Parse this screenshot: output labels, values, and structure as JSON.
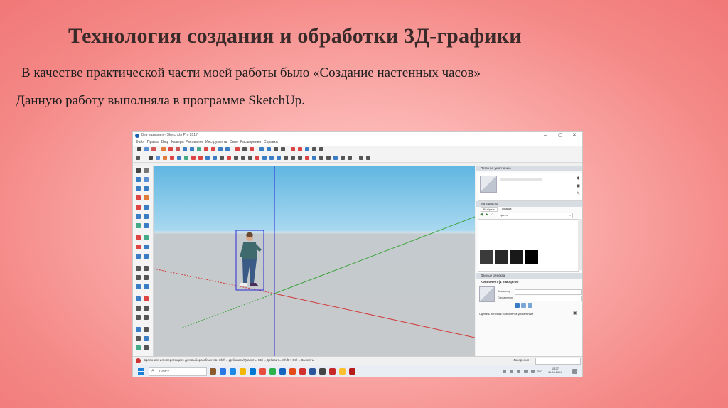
{
  "slide": {
    "title": "Технология создания и обработки 3Д-графики",
    "line1": "В качестве практической части моей работы было  «Создание настенных часов»",
    "line2": "Данную работу выполняла в программе SketchUp."
  },
  "app": {
    "window_title": "Без названия - SketchUp Pro 2017",
    "menu": [
      "Файл",
      "Правка",
      "Вид",
      "Камера",
      "Рисование",
      "Инструменты",
      "Окно",
      "Расширения",
      "Справка"
    ],
    "status_text": "Щелкните или перетащите для выбора объектов. Shift = Добавить/Удалить. Ctrl = Добавить. Shift + Ctrl = Вычесть.",
    "measurements_label": "Измерения",
    "colors": {
      "sky_top": "#5fb6e2",
      "ground": "#c7cacc",
      "axis_red": "#d23a3a",
      "axis_green": "#3aa33a",
      "axis_blue": "#2b2bd6",
      "selection": "#2b2bd6"
    }
  },
  "panel": {
    "tray_title": "Лоток по умолчанию",
    "materials_header": "Материалы",
    "materials_tabs": [
      "Выбрать",
      "Правка"
    ],
    "materials_dropdown": "Цвета",
    "swatch_colors": [
      "#3b3b3b",
      "#2a2a2a",
      "#191919",
      "#000000"
    ],
    "entity_header": "Данные объекта",
    "entity_title": "Компонент (1 в модели)",
    "fields": [
      {
        "label": "Экземпляр",
        "value": ""
      },
      {
        "label": "Определение",
        "value": ""
      }
    ],
    "bottom_link": "Сделать источник компонента уникальным"
  },
  "taskbar": {
    "search_placeholder": "Поиск",
    "time": "15:27",
    "date": "11.04.2024",
    "lang": "РУС"
  }
}
